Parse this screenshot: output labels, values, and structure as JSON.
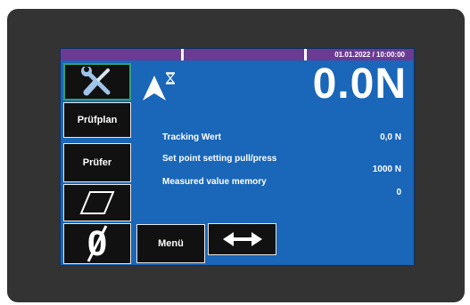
{
  "statusbar": {
    "datetime": "01.01.2022 / 10:00:00"
  },
  "display": {
    "force_value": "0.0N"
  },
  "sidebar": {
    "tools_icon": "tools-icon",
    "pruefplan_label": "Prüfplan",
    "pruefer_label": "Prüfer",
    "shape_icon": "parallelogram-icon",
    "zero_label": "0"
  },
  "readings": [
    {
      "label": "Tracking Wert",
      "value": "0,0 N"
    },
    {
      "label": "Set point setting pull/press",
      "value": "1000 N"
    },
    {
      "label": "Measured value memory",
      "value": "0"
    }
  ],
  "bottom": {
    "menu_label": "Menü",
    "direction_icon": "double-arrow-icon"
  },
  "colors": {
    "screen_bg": "#1a66b8",
    "statusbar_bg": "#6b3b93",
    "bezel": "#333333",
    "button_bg": "#111111",
    "selected_border": "#2fa07a"
  }
}
